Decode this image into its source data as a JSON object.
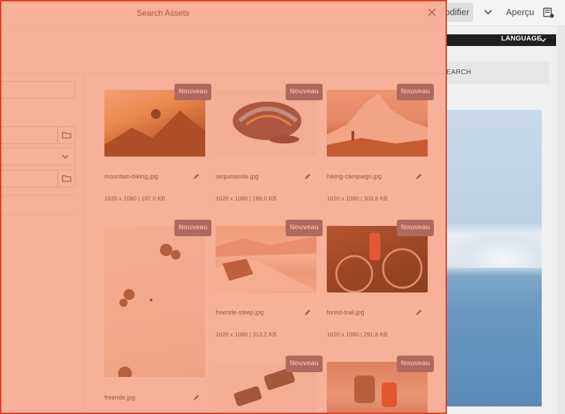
{
  "editor_toolbar": {
    "modifier_label": "odifier",
    "apercu_label": "Aperçu",
    "icons": [
      "chevron-down-icon",
      "page-properties-icon"
    ]
  },
  "page_preview": {
    "language_label": "LANGUAGE",
    "search_label": "EARCH"
  },
  "dialog": {
    "title": "Search Assets",
    "icons": [
      "close-icon",
      "folder-icon",
      "chevron-down-icon",
      "pencil-icon"
    ],
    "new_badge_label": "Nouveau",
    "assets": [
      {
        "filename": "mountain-biking.jpg",
        "meta": "1620 x 1080 | 197.0 KB"
      },
      {
        "filename": "sequoiaside.jpg",
        "meta": "1620 x 1080 | 188.0 KB"
      },
      {
        "filename": "hiking-campaign.jpg",
        "meta": "1620 x 1080 | 303.8 KB"
      },
      {
        "filename": "freeride.jpg",
        "meta": ""
      },
      {
        "filename": "freeride-steep.jpg",
        "meta": "1620 x 1080 | 313.2 KB"
      },
      {
        "filename": "forest-trail.jpg",
        "meta": "1620 x 1080 | 291.8 KB"
      },
      {
        "filename": "",
        "meta": ""
      },
      {
        "filename": "",
        "meta": ""
      }
    ]
  },
  "colors": {
    "highlight_overlay": "#f06432",
    "highlight_border": "#e83a28",
    "badge": "#6e6e8c"
  }
}
